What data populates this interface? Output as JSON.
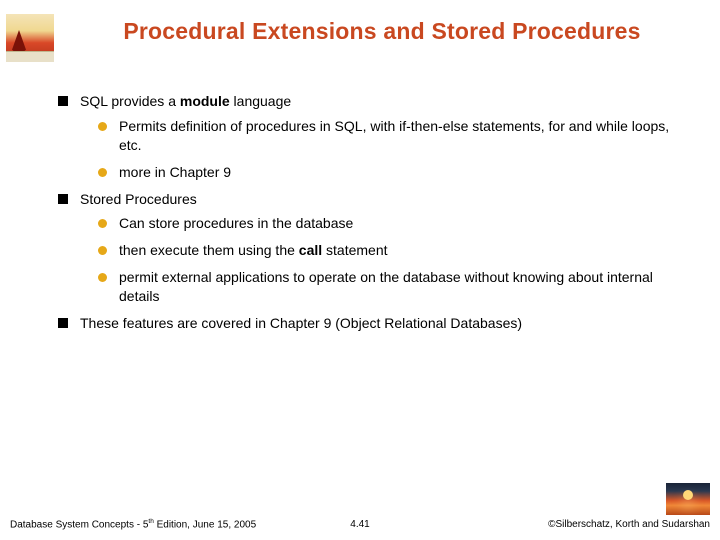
{
  "title": "Procedural Extensions and Stored Procedures",
  "bullets": {
    "b1_pre": "SQL provides a ",
    "b1_bold": "module",
    "b1_post": " language",
    "b1a": "Permits definition of procedures in SQL, with if-then-else statements, for and while loops, etc.",
    "b1b": "more in Chapter 9",
    "b2": "Stored Procedures",
    "b2a": "Can store procedures in the database",
    "b2b_pre": "then execute them using the ",
    "b2b_bold": "call",
    "b2b_post": " statement",
    "b2c": "permit external applications to operate on the database without knowing about internal details",
    "b3": "These features are covered in Chapter 9 (Object Relational Databases)"
  },
  "footer": {
    "left_pre": "Database System Concepts - 5",
    "left_sup": "th",
    "left_post": " Edition,  June 15, 2005",
    "center": "4.41",
    "right": "©Silberschatz, Korth and Sudarshan"
  }
}
